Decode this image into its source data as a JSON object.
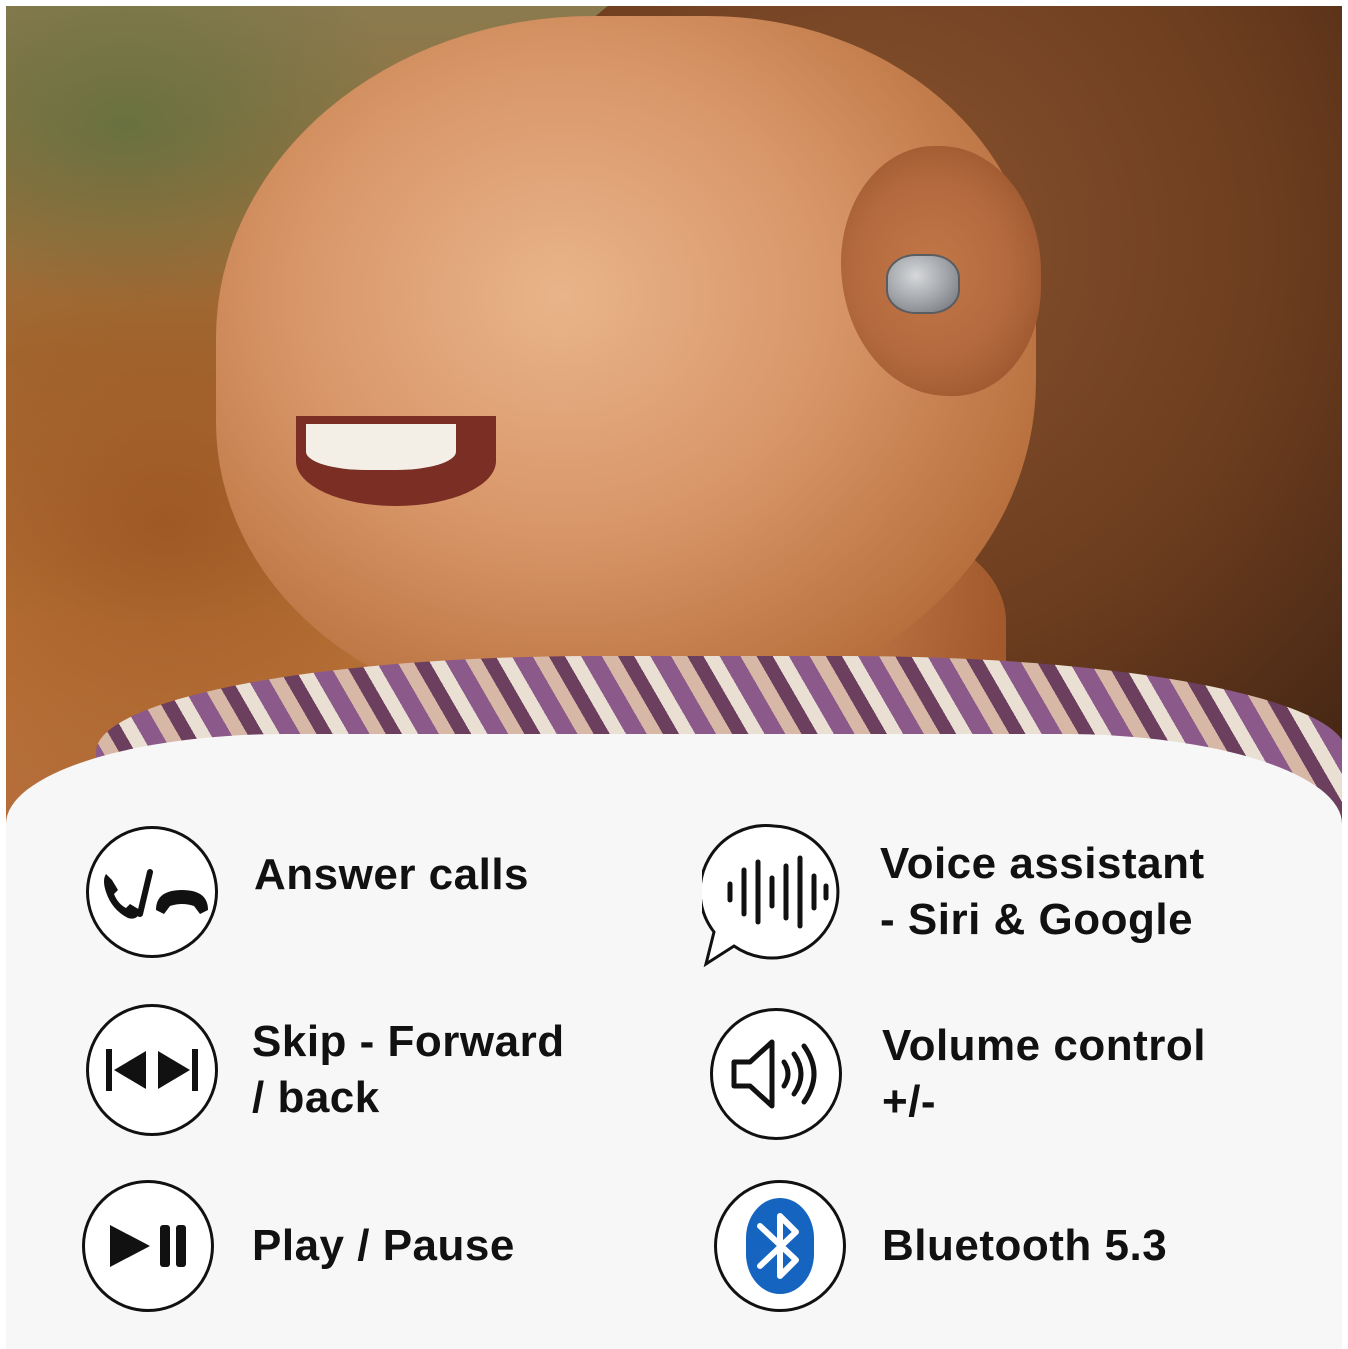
{
  "photo": {
    "description_icon": "woman-with-earbud-photo"
  },
  "features": [
    {
      "id": "answer-calls",
      "label": "Answer calls",
      "icon": "phone-answer-hangup-icon"
    },
    {
      "id": "voice-assistant",
      "label": "Voice assistant\n- Siri & Google",
      "icon": "voice-wave-speech-bubble-icon"
    },
    {
      "id": "skip",
      "label": "Skip - Forward\n/ back",
      "icon": "skip-back-forward-icon"
    },
    {
      "id": "volume",
      "label": "Volume control\n+/-",
      "icon": "speaker-volume-icon"
    },
    {
      "id": "play-pause",
      "label": "Play / Pause",
      "icon": "play-pause-icon"
    },
    {
      "id": "bluetooth",
      "label": "Bluetooth 5.3",
      "icon": "bluetooth-icon"
    }
  ],
  "colors": {
    "panel": "#f7f7f8",
    "icon_stroke": "#111111",
    "bluetooth_blue": "#1565c0"
  }
}
